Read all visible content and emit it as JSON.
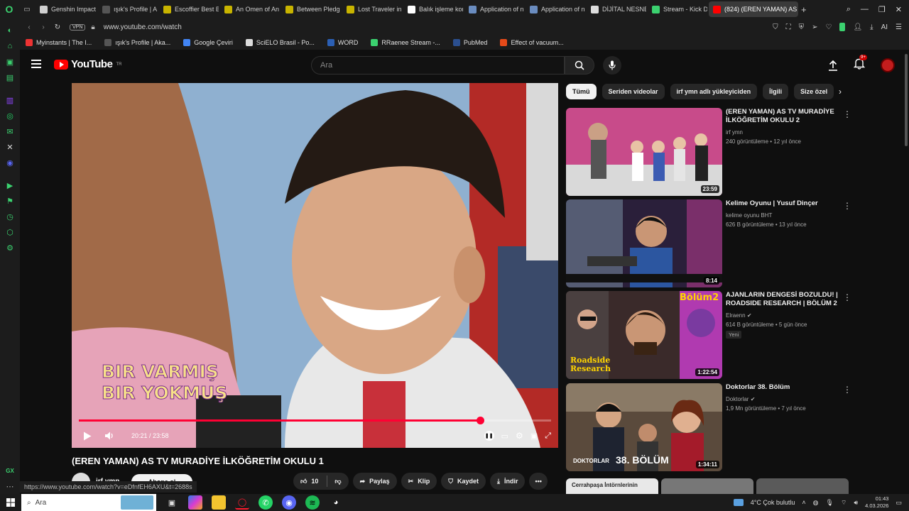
{
  "browser": {
    "tabs": [
      {
        "label": "Genshin Impact",
        "color": "#cfcfcf"
      },
      {
        "label": "ışık's Profile | A",
        "color": "#555"
      },
      {
        "label": "Escoffier Best B",
        "color": "#c8b400"
      },
      {
        "label": "An Omen of An",
        "color": "#c8b400"
      },
      {
        "label": "Between Pledg",
        "color": "#c8b400"
      },
      {
        "label": "Lost Traveler in",
        "color": "#c8b400"
      },
      {
        "label": "Balık işleme kon",
        "color": "#fff"
      },
      {
        "label": "Application of n",
        "color": "#6a8cbf"
      },
      {
        "label": "Application of n",
        "color": "#6a8cbf"
      },
      {
        "label": "DİJİTAL NESNE",
        "color": "#ddd"
      },
      {
        "label": "Stream - Kick D",
        "color": "#3bd16f"
      },
      {
        "label": "(824) (EREN YAMAN) AS T",
        "color": "#ff0000",
        "active": true
      }
    ],
    "url": "www.youtube.com/watch",
    "vpn_label": "VPN",
    "ai_label": "AI",
    "bookmarks": [
      {
        "label": "Myinstants | The I...",
        "color": "#e33"
      },
      {
        "label": "ışık's Profile | Aka...",
        "color": "#555"
      },
      {
        "label": "Google Çeviri",
        "color": "#4285f4"
      },
      {
        "label": "SciELO Brasil - Po...",
        "color": "#ddd"
      },
      {
        "label": "WORD",
        "color": "#2b5fb4"
      },
      {
        "label": "RRaenee Stream -...",
        "color": "#3bd16f"
      },
      {
        "label": "PubMed",
        "color": "#2b4f8f"
      },
      {
        "label": "Effect of vacuum...",
        "color": "#e64a19"
      }
    ]
  },
  "youtube": {
    "logo_text": "YouTube",
    "logo_region": "TR",
    "search_placeholder": "Ara",
    "notification_count": "9+",
    "video": {
      "title": "(EREN YAMAN) AS TV MURADİYE İLKÖĞRETİM OKULU 1",
      "current_time": "20:21 / 23:58",
      "progress": 0.85,
      "overlay_line1": "BIR VARMIŞ",
      "overlay_line2": "BIR YOKMUŞ",
      "channel": "irf ymn",
      "subscribe_label": "Abone ol",
      "likes": "10",
      "share_label": "Paylaş",
      "clip_label": "Klip",
      "save_label": "Kaydet",
      "download_label": "İndir",
      "status_url": "https://www.youtube.com/watch?v=eDfnfEH6AXU&t=2688s"
    },
    "chips": [
      "Tümü",
      "Seriden videolar",
      "irf ymn adlı yükleyiciden",
      "İlgili",
      "Size özel"
    ],
    "recommendations": [
      {
        "title": "(EREN YAMAN) AS TV MURADİYE İLKÖĞRETİM OKULU 2",
        "channel": "irf ymn",
        "meta": "240 görüntüleme • 12 yıl önce",
        "duration": "23:59",
        "verified": false,
        "new": false
      },
      {
        "title": "Kelime Oyunu | Yusuf Dinçer",
        "channel": "kelime oyunu BHT",
        "meta": "626 B görüntüleme • 13 yıl önce",
        "duration": "8:14",
        "verified": false,
        "new": false
      },
      {
        "title": "AJANLARIN DENGESİ BOZULDU! | ROADSIDE RESEARCH | BÖLÜM 2",
        "channel": "Elraenn",
        "meta": "614 B görüntüleme • 5 gün önce",
        "duration": "1:22:54",
        "verified": true,
        "new": true,
        "new_label": "Yeni",
        "thumb_text1": "Bölüm2",
        "thumb_text2": "Roadside Research"
      },
      {
        "title": "Doktorlar 38. Bölüm",
        "channel": "Doktorlar",
        "meta": "1,9 Mn görüntüleme • 7 yıl önce",
        "duration": "1:34:11",
        "verified": true,
        "new": false,
        "thumb_text1": "DOKTORLAR",
        "thumb_text2": "38. BÖLÜM"
      }
    ],
    "next_thumb_text": "Cerrahpaşa İntörnlerinin"
  },
  "taskbar": {
    "search_label": "Ara",
    "weather": "4°C  Çok bulutlu",
    "time": "01:43",
    "date": "4.03.2026"
  }
}
